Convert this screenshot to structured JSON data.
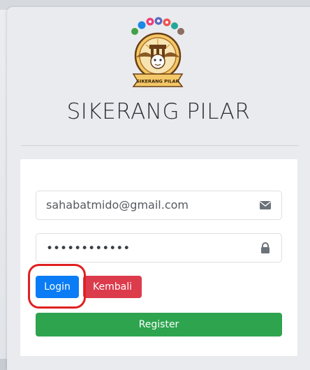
{
  "app": {
    "title": "SIKERANG PILAR"
  },
  "logo": {
    "icon": "sikerang-pilar-emblem",
    "banner_text": "SIKERANG PILAR",
    "colors": {
      "gold": "#e9b54a",
      "brown": "#6b3e16",
      "cream": "#f7e4b3"
    }
  },
  "form": {
    "email": {
      "value": "sahabatmido@gmail.com",
      "icon": "envelope-icon"
    },
    "password": {
      "value": "••••••••••••",
      "icon": "lock-icon"
    },
    "login_label": "Login",
    "back_label": "Kembali",
    "register_label": "Register"
  },
  "colors": {
    "login": "#0a7cf5",
    "back": "#dc3b4c",
    "register": "#2ea44f",
    "highlight": "#e02020"
  }
}
